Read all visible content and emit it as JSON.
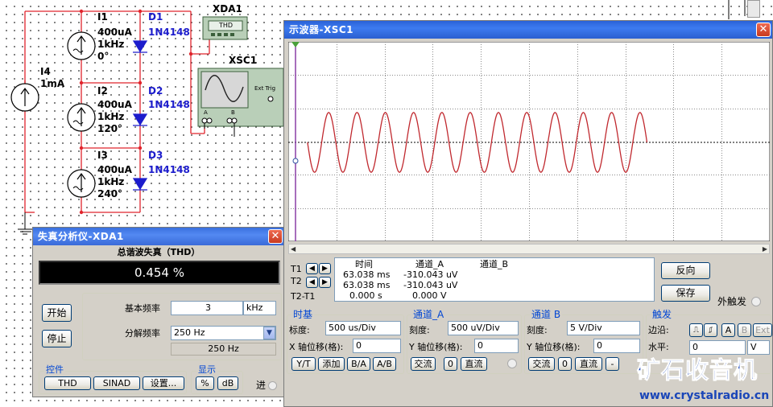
{
  "schematic": {
    "sources": [
      {
        "name": "I1",
        "amplitude": "400uA",
        "freq": "1kHz",
        "phase": "0°"
      },
      {
        "name": "I2",
        "amplitude": "400uA",
        "freq": "1kHz",
        "phase": "120°"
      },
      {
        "name": "I3",
        "amplitude": "400uA",
        "freq": "1kHz",
        "phase": "240°"
      }
    ],
    "dc_source": {
      "name": "I4",
      "value": "1mA"
    },
    "diodes": [
      {
        "name": "D1",
        "model": "1N4148"
      },
      {
        "name": "D2",
        "model": "1N4148"
      },
      {
        "name": "D3",
        "model": "1N4148"
      }
    ],
    "xda_label": "XDA1",
    "xda_icon_text": "THD",
    "xsc_label": "XSC1",
    "xsc_ext_trig": "Ext Trig",
    "xsc_a": "A",
    "xsc_b": "B"
  },
  "distortion_analyzer": {
    "title": "失真分析仪-XDA1",
    "thd_label": "总谐波失真（THD）",
    "thd_value": "0.454 %",
    "start_button": "开始",
    "stop_button": "停止",
    "fundamental_label": "基本频率",
    "fundamental_value": "3",
    "fundamental_unit": "kHz",
    "resolution_label": "分解频率",
    "resolution_value": "250 Hz",
    "resolution_display": "250 Hz",
    "controls_group": "控件",
    "display_group": "显示",
    "thd_button": "THD",
    "sinad_button": "SINAD",
    "settings_button": "设置...",
    "percent_button": "%",
    "db_button": "dB",
    "in_label": "进"
  },
  "oscilloscope": {
    "title": "示波器-XSC1",
    "readout": {
      "time_header": "时间",
      "ch_a_header": "通道_A",
      "ch_b_header": "通道_B",
      "rows": [
        {
          "label": "T1",
          "time": "63.038 ms",
          "a": "-310.043 uV",
          "b": ""
        },
        {
          "label": "T2",
          "time": "63.038 ms",
          "a": "-310.043 uV",
          "b": ""
        },
        {
          "label": "T2-T1",
          "time": "0.000 s",
          "a": "0.000 V",
          "b": ""
        }
      ]
    },
    "reverse_button": "反向",
    "save_button": "保存",
    "ext_trigger_label": "外触发",
    "timebase": {
      "title": "时基",
      "scale_label": "标度:",
      "scale_value": "500 us/Div",
      "xpos_label": "X 轴位移(格):",
      "xpos_value": "0",
      "yt": "Y/T",
      "add": "添加",
      "ba": "B/A",
      "ab": "A/B"
    },
    "channel_a": {
      "title": "通道_A",
      "scale_label": "刻度:",
      "scale_value": "500 uV/Div",
      "ypos_label": "Y 轴位移(格):",
      "ypos_value": "0",
      "ac": "交流",
      "zero": "0",
      "dc": "直流"
    },
    "channel_b": {
      "title": "通道 B",
      "scale_label": "刻度:",
      "scale_value": "5  V/Div",
      "ypos_label": "Y 轴位移(格):",
      "ypos_value": "0",
      "ac": "交流",
      "zero": "0",
      "dc": "直流",
      "minus": "-"
    },
    "trigger": {
      "title": "触发",
      "edge_label": "边沿:",
      "level_label": "水平:",
      "level_value": "0",
      "level_unit": "V",
      "a": "A",
      "b": "B",
      "ext": "Ext"
    },
    "waveform": {
      "cycles": 12,
      "start_fraction": 0.04,
      "end_fraction": 0.745,
      "amplitude_div": 0.9,
      "color": "#c0282e"
    }
  },
  "watermark": {
    "brand": "矿石收音机",
    "url": "www.crystalradio.cn"
  },
  "colors": {
    "wire": "#e0242c",
    "diode": "#1c1ccc",
    "title_bar": "#2a62d7",
    "trace": "#c0282e"
  }
}
